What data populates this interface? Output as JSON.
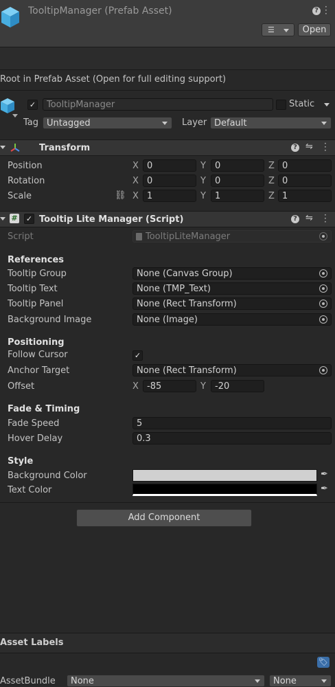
{
  "header": {
    "title": "TooltipManager (Prefab Asset)",
    "open_label": "Open"
  },
  "notice": "Root in Prefab Asset (Open for full editing support)",
  "gameobject": {
    "name": "TooltipManager",
    "static_label": "Static",
    "tag_label": "Tag",
    "tag_value": "Untagged",
    "layer_label": "Layer",
    "layer_value": "Default"
  },
  "transform": {
    "title": "Transform",
    "rows": [
      {
        "label": "Position",
        "x": "0",
        "y": "0",
        "z": "0"
      },
      {
        "label": "Rotation",
        "x": "0",
        "y": "0",
        "z": "0"
      },
      {
        "label": "Scale",
        "x": "1",
        "y": "1",
        "z": "1"
      }
    ],
    "axes": {
      "x": "X",
      "y": "Y",
      "z": "Z"
    }
  },
  "script_comp": {
    "title": "Tooltip Lite Manager (Script)",
    "script_label": "Script",
    "script_value": "TooltipLiteManager",
    "references": {
      "header": "References",
      "rows": [
        {
          "label": "Tooltip Group",
          "value": "None (Canvas Group)"
        },
        {
          "label": "Tooltip Text",
          "value": "None (TMP_Text)"
        },
        {
          "label": "Tooltip Panel",
          "value": "None (Rect Transform)"
        },
        {
          "label": "Background Image",
          "value": "None (Image)"
        }
      ]
    },
    "positioning": {
      "header": "Positioning",
      "follow_label": "Follow Cursor",
      "anchor_label": "Anchor Target",
      "anchor_value": "None (Rect Transform)",
      "offset_label": "Offset",
      "offset_x": "-85",
      "offset_y": "-20"
    },
    "fade": {
      "header": "Fade & Timing",
      "speed_label": "Fade Speed",
      "speed_value": "5",
      "delay_label": "Hover Delay",
      "delay_value": "0.3"
    },
    "style": {
      "header": "Style",
      "bg_label": "Background Color",
      "bg_color": "#d0d0d0",
      "text_label": "Text Color",
      "text_color": "#000000"
    }
  },
  "add_component_label": "Add Component",
  "footer": {
    "asset_labels": "Asset Labels",
    "assetbundle_label": "AssetBundle",
    "bundle_value": "None",
    "variant_value": "None"
  },
  "colors": {
    "accent_tag": "#3a6ea8"
  }
}
